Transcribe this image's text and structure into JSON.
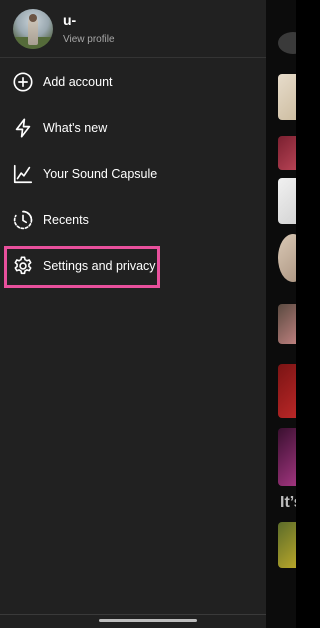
{
  "profile": {
    "username": "u-",
    "view_profile_label": "View profile"
  },
  "menu": {
    "items": [
      {
        "label": "Add account",
        "icon": "plus-circle-icon"
      },
      {
        "label": "What's new",
        "icon": "lightning-icon"
      },
      {
        "label": "Your Sound Capsule",
        "icon": "chart-line-icon"
      },
      {
        "label": "Recents",
        "icon": "history-clock-icon"
      },
      {
        "label": "Settings and privacy",
        "icon": "gear-icon"
      }
    ]
  },
  "background": {
    "heading_fragment": "It’s"
  },
  "colors": {
    "drawer_bg": "#212121",
    "highlight": "#e8509c",
    "text_primary": "#ffffff",
    "text_secondary": "#a7a7a7"
  }
}
